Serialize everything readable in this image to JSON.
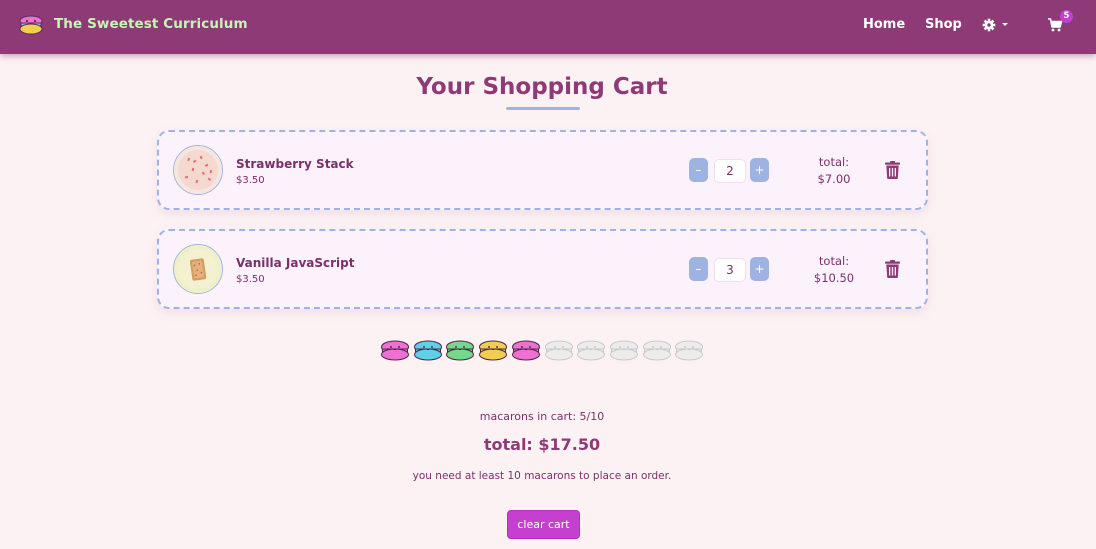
{
  "nav": {
    "brand_title": "The Sweetest Curriculum",
    "home_label": "Home",
    "shop_label": "Shop",
    "settings_icon": "gear-icon",
    "cart_icon": "cart-icon",
    "cart_count": "5"
  },
  "page": {
    "title": "Your Shopping Cart"
  },
  "cart": {
    "items": [
      {
        "name": "Strawberry Stack",
        "price": "$3.50",
        "quantity": "2",
        "total_label": "total:",
        "total": "$7.00"
      },
      {
        "name": "Vanilla JavaScript",
        "price": "$3.50",
        "quantity": "3",
        "total_label": "total:",
        "total": "$10.50"
      }
    ],
    "decrement_label": "–",
    "increment_label": "+"
  },
  "progress": {
    "filled": 5,
    "capacity": 10,
    "filled_colors": [
      "#f06fd3",
      "#5fcfea",
      "#75d88a",
      "#f1cd52",
      "#f06fd3"
    ],
    "empty_color": "#ececec"
  },
  "summary": {
    "count_text": "macarons in cart: 5/10",
    "total_text": "total: $17.50",
    "note": "you need at least 10 macarons to place an order.",
    "clear_label": "clear cart"
  },
  "colors": {
    "navbar": "#8e3a77",
    "brand_text": "#c7f5b8",
    "accent": "#c540cf",
    "border": "#9fb3e3",
    "background": "#fdf2f3"
  }
}
